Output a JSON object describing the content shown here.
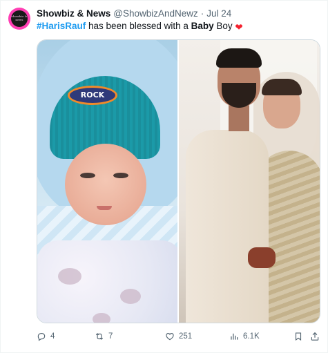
{
  "author": {
    "avatar_text": "showbiz & news",
    "display_name": "Showbiz & News",
    "handle": "@ShowbizAndNewz",
    "separator": "·",
    "date": "Jul 24"
  },
  "tweet": {
    "hashtag": "#HarisRauf",
    "text_before_bold": " has been blessed with a ",
    "bold_word": "Baby",
    "text_after_bold": " Boy ",
    "emoji": "❤"
  },
  "media": {
    "photos": [
      "newborn-baby-photo",
      "couple-wedding-photo"
    ],
    "hat_patch_text": "ROCK"
  },
  "actions": {
    "replies": "4",
    "retweets": "7",
    "likes": "251",
    "views": "6.1K"
  },
  "colors": {
    "accent": "#1d9bf0",
    "heart": "#f4212e",
    "muted": "#536471",
    "avatar_bg": "#ff3fb4"
  },
  "icons": [
    "reply-icon",
    "retweet-icon",
    "like-icon",
    "views-icon",
    "bookmark-icon",
    "share-icon"
  ]
}
